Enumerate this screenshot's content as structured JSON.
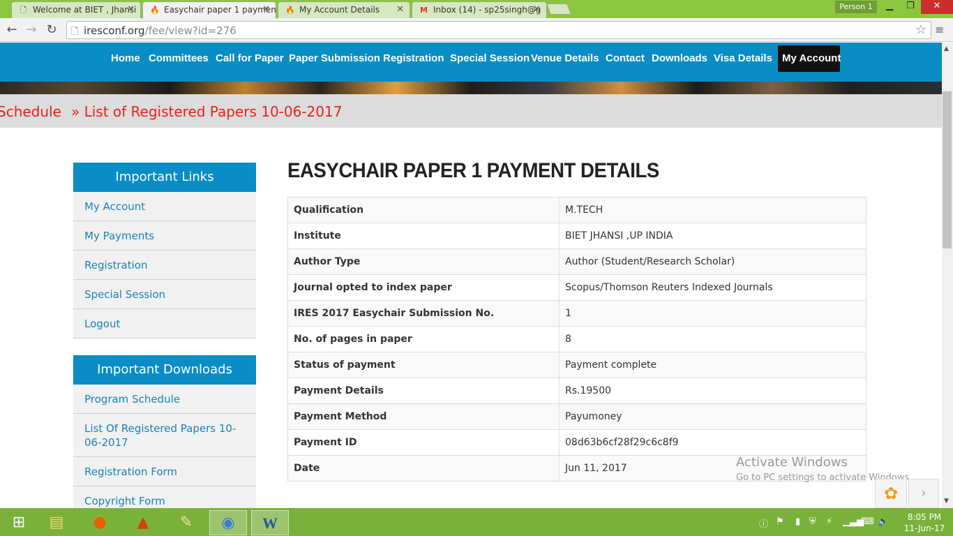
{
  "browser": {
    "tabs": [
      {
        "title": "Welcome at BIET , Jhansi",
        "icon": "page-icon",
        "active": false
      },
      {
        "title": "Easychair paper 1 paymen",
        "icon": "torch-icon",
        "active": true
      },
      {
        "title": "My Account Details",
        "icon": "torch-icon",
        "active": false
      },
      {
        "title": "Inbox (14) - sp25singh@g",
        "icon": "gmail-icon",
        "active": false
      }
    ],
    "profile": "Person 1",
    "url_host": "iresconf.org",
    "url_path": "/fee/view?id=276",
    "window_buttons": {
      "minimize": "▁",
      "maximize": "❐",
      "close": "✕"
    }
  },
  "nav": {
    "items": [
      "Home",
      "Committees",
      "Call for Paper",
      "Paper Submission",
      "Registration",
      "Special Session",
      "Venue Details",
      "Contact",
      "Downloads",
      "Visa Details",
      "My Account"
    ],
    "active": "My Account"
  },
  "ticker": {
    "items": [
      "Schedule",
      "» List of Registered Papers 10-06-2017"
    ]
  },
  "sidebar": {
    "links_title": "Important Links",
    "links": [
      "My Account",
      "My Payments",
      "Registration",
      "Special Session",
      "Logout"
    ],
    "downloads_title": "Important Downloads",
    "downloads": [
      "Program Schedule",
      "List Of Registered Papers 10-06-2017",
      "Registration Form",
      "Copyright Form"
    ]
  },
  "main": {
    "title": "EASYCHAIR PAPER 1 PAYMENT DETAILS",
    "rows": [
      {
        "label": "Qualification",
        "value": "M.TECH"
      },
      {
        "label": "Institute",
        "value": "BIET JHANSI ,UP INDIA"
      },
      {
        "label": "Author Type",
        "value": "Author (Student/Research Scholar)"
      },
      {
        "label": "Journal opted to index paper",
        "value": "Scopus/Thomson Reuters Indexed Journals"
      },
      {
        "label": "IRES 2017 Easychair Submission No.",
        "value": "1"
      },
      {
        "label": "No. of pages in paper",
        "value": "8"
      },
      {
        "label": "Status of payment",
        "value": "Payment complete"
      },
      {
        "label": "Payment Details",
        "value": "Rs.19500"
      },
      {
        "label": "Payment Method",
        "value": "Payumoney"
      },
      {
        "label": "Payment ID",
        "value": "08d63b6cf28f29c6c8f9"
      },
      {
        "label": "Date",
        "value": "Jun 11, 2017"
      }
    ]
  },
  "watermark": {
    "line1": "Activate Windows",
    "line2": "Go to PC settings to activate Windows."
  },
  "taskbar": {
    "apps": [
      "windows-start-icon",
      "file-explorer-icon",
      "firefox-icon",
      "matlab-icon",
      "paint-icon",
      "chrome-icon",
      "word-icon"
    ],
    "time": "8:05 PM",
    "date": "11-Jun-17"
  },
  "colors": {
    "nav_bg": "#0a8dc4",
    "ticker_text": "#e8201c",
    "link": "#1a82b8",
    "chrome_frame": "#8cc63f",
    "taskbar": "#7ab13b"
  }
}
